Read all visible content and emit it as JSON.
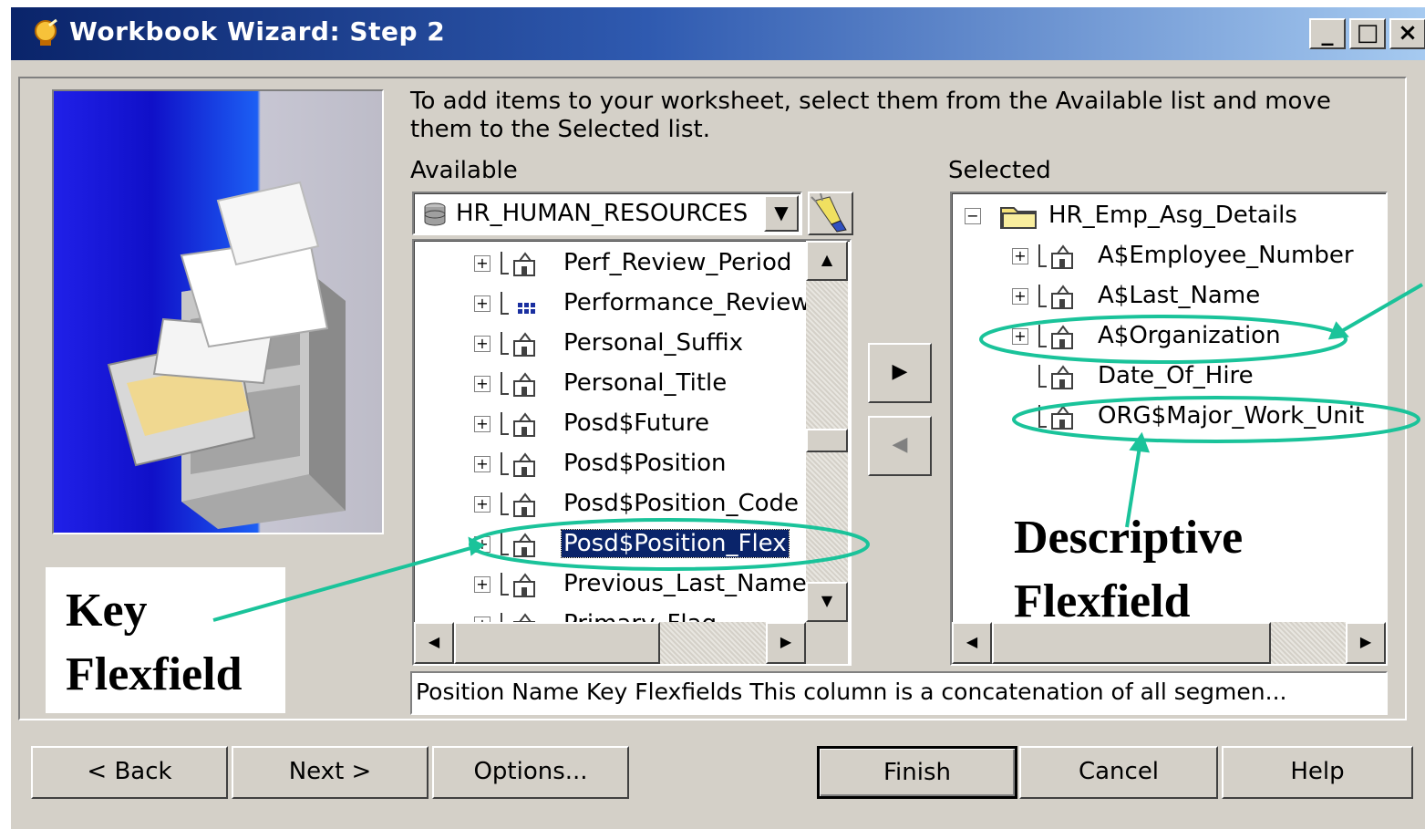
{
  "window": {
    "title": "Workbook Wizard: Step 2",
    "controls": [
      "_",
      "□",
      "×"
    ]
  },
  "instructions": "To add items to your worksheet, select them from the Available list and move them to the Selected list.",
  "available": {
    "label": "Available",
    "combo_value": "HR_HUMAN_RESOURCES",
    "items": [
      {
        "label": "Perf_Review_Period",
        "icon": "item-icon"
      },
      {
        "label": "Performance_Review",
        "icon": "grid-item-icon"
      },
      {
        "label": "Personal_Suffix",
        "icon": "item-icon"
      },
      {
        "label": "Personal_Title",
        "icon": "item-icon"
      },
      {
        "label": "Posd$Future",
        "icon": "item-icon"
      },
      {
        "label": "Posd$Position",
        "icon": "item-icon"
      },
      {
        "label": "Posd$Position_Code",
        "icon": "item-icon"
      },
      {
        "label": "Posd$Position_Flex",
        "icon": "item-icon",
        "selected": true
      },
      {
        "label": "Previous_Last_Name",
        "icon": "item-icon"
      },
      {
        "label": "Primary_Flag",
        "icon": "item-icon"
      }
    ]
  },
  "selected": {
    "label": "Selected",
    "folder": "HR_Emp_Asg_Details",
    "items": [
      {
        "label": "A$Employee_Number",
        "expandable": true
      },
      {
        "label": "A$Last_Name",
        "expandable": true
      },
      {
        "label": "A$Organization",
        "expandable": true
      },
      {
        "label": "Date_Of_Hire",
        "expandable": false
      },
      {
        "label": "ORG$Major_Work_Unit",
        "expandable": false
      }
    ]
  },
  "description": "Position Name Key Flexfields This column is a concatenation of all segmen...",
  "buttons": {
    "back": "< Back",
    "next": "Next >",
    "options": "Options...",
    "finish": "Finish",
    "cancel": "Cancel",
    "help": "Help"
  },
  "annotations": {
    "key_flexfield": [
      "Key",
      "Flexfield"
    ],
    "descriptive_flexfield": [
      "Descriptive",
      "Flexfield"
    ],
    "highlight_color": "#1ac39a"
  },
  "colors": {
    "titlebar": "#0a246a",
    "face": "#d4d0c8",
    "selection": "#0a246a"
  }
}
